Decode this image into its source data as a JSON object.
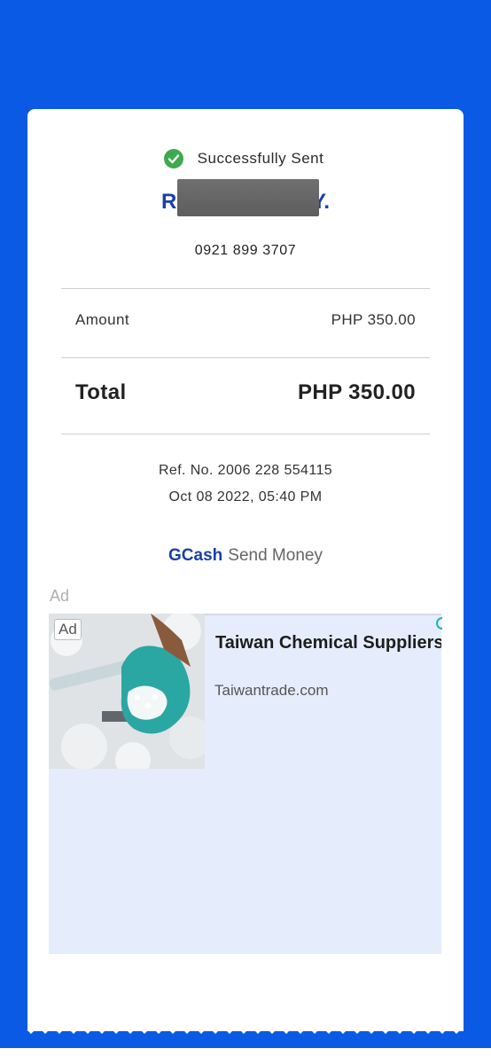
{
  "status": {
    "text": "Successfully Sent",
    "icon": "check-circle-icon",
    "icon_color": "#3daa4f"
  },
  "recipient": {
    "name_start": "R",
    "name_end": "Y.",
    "phone": "0921 899 3707"
  },
  "amount": {
    "label": "Amount",
    "value": "PHP 350.00"
  },
  "total": {
    "label": "Total",
    "value": "PHP 350.00"
  },
  "transaction": {
    "ref": "Ref. No. 2006 228 554115",
    "datetime": "Oct 08 2022, 05:40 PM"
  },
  "brand": {
    "name": "GCash",
    "service": "Send Money"
  },
  "ad": {
    "section_label": "Ad",
    "badge": "Ad",
    "title": "Taiwan Chemical Suppliers",
    "url": "Taiwantrade.com"
  },
  "colors": {
    "background": "#0a5ae6",
    "brand_blue": "#1a3fa8",
    "ad_background": "#e5edfc"
  }
}
